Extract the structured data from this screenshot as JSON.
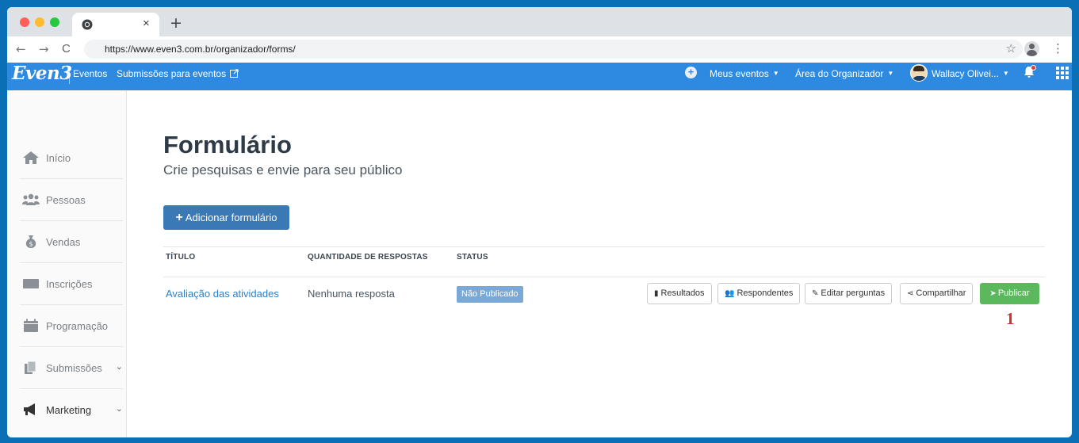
{
  "browser": {
    "tab_close": "×",
    "new_tab": "+",
    "url": "https://www.even3.com.br/organizador/forms/",
    "back": "←",
    "forward": "→",
    "reload": "C",
    "star": "☆",
    "menu": "⋮"
  },
  "appbar": {
    "logo": "Even3",
    "eventos": "Eventos",
    "submissoes_link": "Submissões para eventos",
    "meus_eventos": "Meus eventos",
    "area_organizador": "Área do Organizador",
    "user_name": "Wallacy Olivei...",
    "caret": "▼",
    "plus": "+"
  },
  "sidebar": {
    "items": [
      {
        "label": "Início"
      },
      {
        "label": "Pessoas"
      },
      {
        "label": "Vendas"
      },
      {
        "label": "Inscrições"
      },
      {
        "label": "Programação"
      },
      {
        "label": "Submissões"
      },
      {
        "label": "Marketing"
      }
    ],
    "chevron": "⌄"
  },
  "main": {
    "title": "Formulário",
    "subtitle": "Crie pesquisas e envie para seu público",
    "add_button": "Adicionar formulário",
    "add_plus": "+",
    "table": {
      "headers": [
        "TÍTULO",
        "QUANTIDADE DE RESPOSTAS",
        "STATUS"
      ],
      "row": {
        "title": "Avaliação das atividades",
        "responses": "Nenhuma resposta",
        "status": "Não Publicado"
      },
      "actions": {
        "resultados": "Resultados",
        "respondentes": "Respondentes",
        "editar": "Editar perguntas",
        "compartilhar": "Compartilhar",
        "publicar": "Publicar"
      }
    },
    "annotation_marker": "1"
  },
  "colors": {
    "appbar": "#2d8ae0",
    "primary_button": "#3a79b6",
    "publish_button": "#5cb85c",
    "badge": "#7aa9d8",
    "marker": "#d32f2f"
  }
}
